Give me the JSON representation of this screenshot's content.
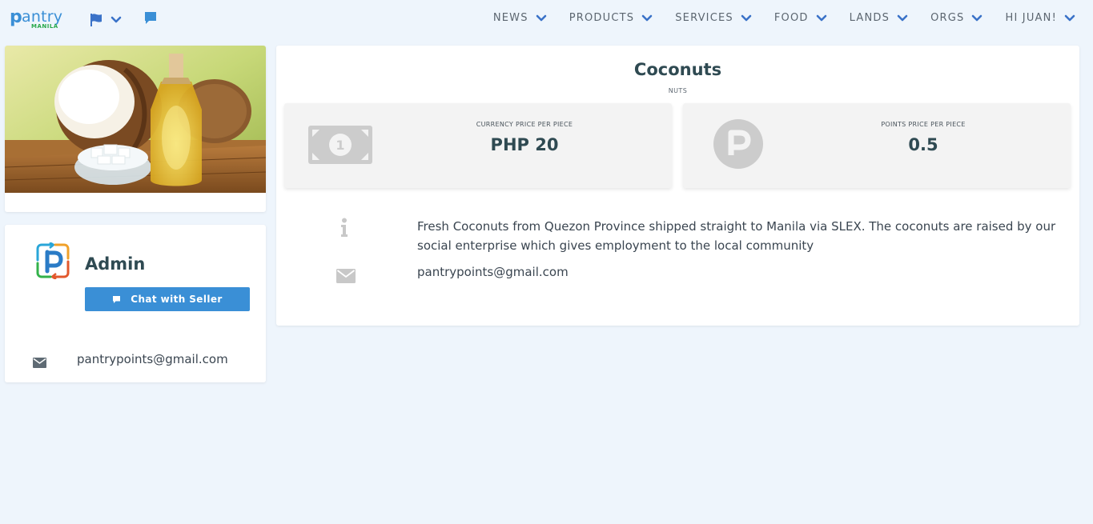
{
  "brand": {
    "logo_letter": "p",
    "logo_word": "antry",
    "logo_sub": "MANILA",
    "accent": "#3a8fd6",
    "green": "#27a84a"
  },
  "topbar": {
    "icons": [
      "flag-icon",
      "chevron-down-icon",
      "chat-icon"
    ],
    "nav": [
      {
        "label": "NEWS"
      },
      {
        "label": "PRODUCTS"
      },
      {
        "label": "SERVICES"
      },
      {
        "label": "FOOD"
      },
      {
        "label": "LANDS"
      },
      {
        "label": "ORGS"
      },
      {
        "label": "HI JUAN!"
      }
    ]
  },
  "seller": {
    "name": "Admin",
    "chat_button": "Chat with Seller",
    "email": "pantrypoints@gmail.com"
  },
  "product": {
    "title": "Coconuts",
    "category": "NUTS",
    "currency_label": "CURRENCY PRICE PER PIECE",
    "currency_value": "PHP 20",
    "points_label": "POINTS PRICE PER PIECE",
    "points_value": "0.5",
    "description": "Fresh Coconuts from Quezon Province shipped straight to Manila via SLEX. The coconuts are raised by our social enterprise which gives employment to the local community",
    "email": "pantrypoints@gmail.com"
  }
}
